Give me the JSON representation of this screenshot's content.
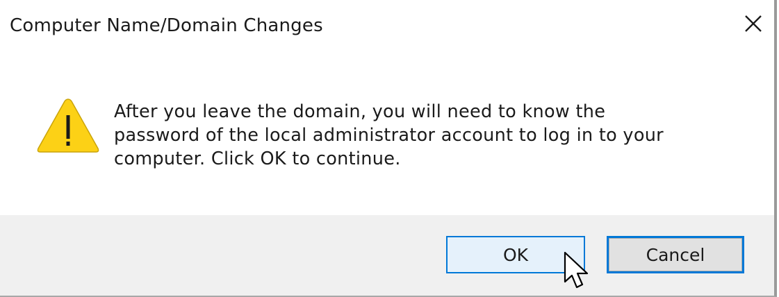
{
  "dialog": {
    "title": "Computer Name/Domain Changes",
    "close_icon": "close-icon",
    "warning_icon": "warning-triangle-icon",
    "message_lines": [
      "After you leave the domain, you will need to know the",
      "password of the local administrator account to log in to your",
      "computer. Click OK to continue."
    ],
    "buttons": {
      "ok_label": "OK",
      "cancel_label": "Cancel"
    },
    "colors": {
      "accent": "#0078d7",
      "warning_fill": "#fcd116",
      "footer_bg": "#f0f0f0"
    }
  }
}
